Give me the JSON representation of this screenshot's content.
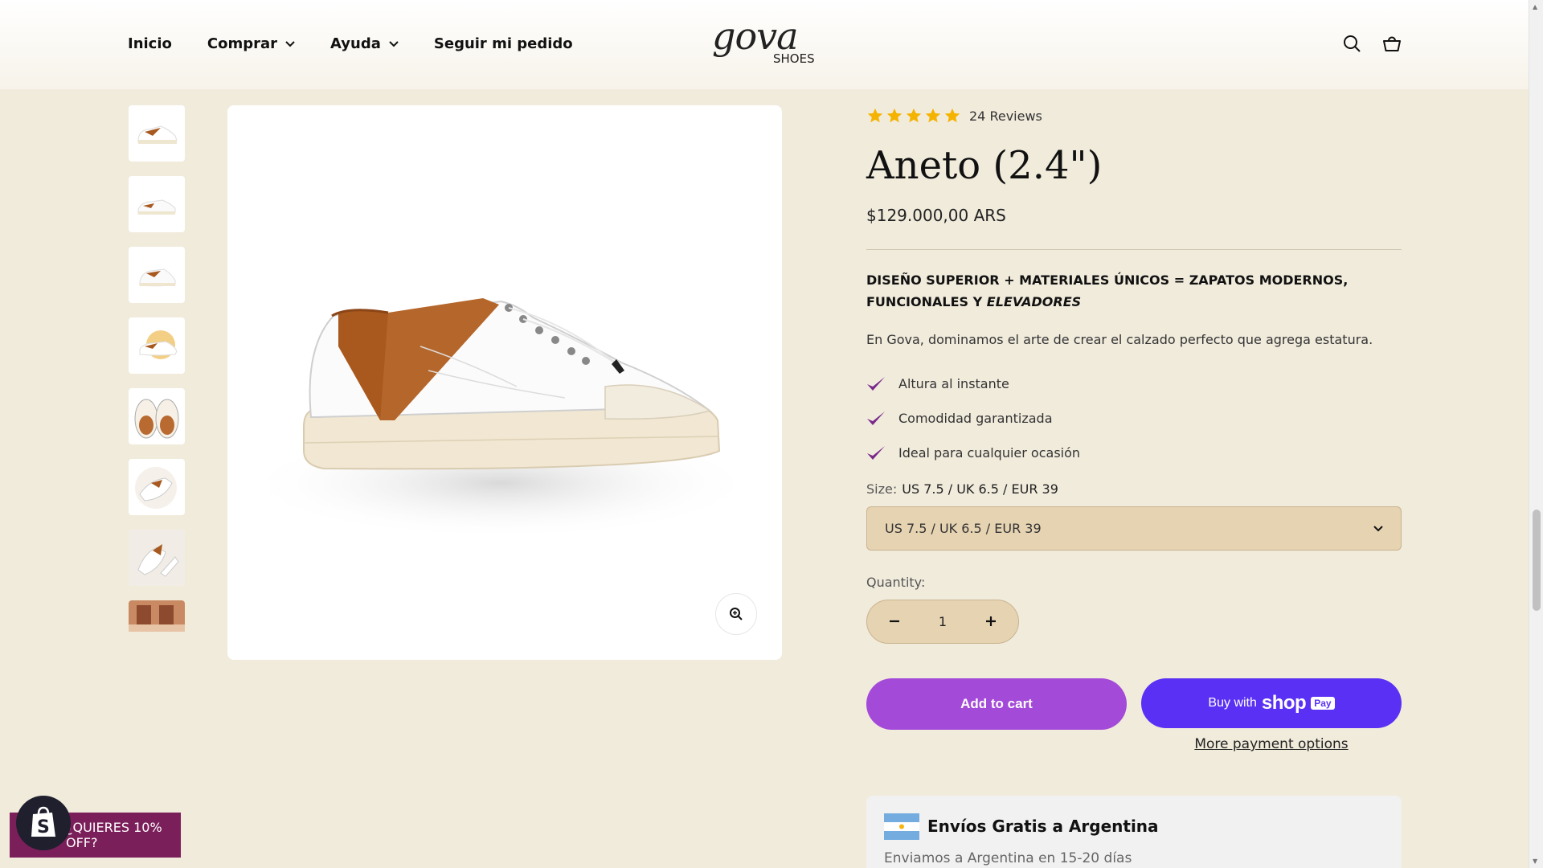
{
  "nav": {
    "items": [
      {
        "label": "Inicio"
      },
      {
        "label": "Comprar"
      },
      {
        "label": "Ayuda"
      },
      {
        "label": "Seguir mi pedido"
      }
    ]
  },
  "logo": {
    "word": "gova",
    "sub": "SHOES"
  },
  "product": {
    "reviews": "24 Reviews",
    "rating": 5,
    "title": "Aneto (2.4\")",
    "price": "$129.000,00 ARS",
    "headline_main": "DISEÑO SUPERIOR + MATERIALES ÚNICOS = ZAPATOS MODERNOS, FUNCIONALES Y ",
    "headline_em": "ELEVADORES",
    "description": "En Gova, dominamos el arte de crear el calzado perfecto que agrega estatura.",
    "features": [
      "Altura al instante",
      "Comodidad garantizada",
      "Ideal para cualquier ocasión"
    ],
    "size_label": "Size:",
    "size_value": "US 7.5 / UK 6.5 / EUR 39",
    "size_selected": "US 7.5 / UK 6.5 / EUR 39",
    "qty_label": "Quantity:",
    "qty_value": "1",
    "add_to_cart": "Add to cart",
    "buy_with": "Buy with",
    "shop_word": "shop",
    "pay_badge": "Pay",
    "more_payment": "More payment options"
  },
  "shipping": {
    "title": "Envíos Gratis a Argentina",
    "subtitle": "Enviamos a Argentina en 15-20 días"
  },
  "promo": {
    "label": "¿QUIERES 10% OFF?"
  },
  "colors": {
    "background": "#f1ebdc",
    "accent_purple": "#a44ad8",
    "shop_pay": "#5a31f4",
    "check_purple": "#7a2a8c",
    "select_bg": "#e6d3b2",
    "star": "#f5b301",
    "promo": "#7b1f5a"
  },
  "icons": [
    "chevron-down-icon",
    "search-icon",
    "cart-icon",
    "star-icon",
    "check-icon",
    "zoom-icon",
    "minus-icon",
    "plus-icon",
    "shopify-icon",
    "argentina-flag-icon"
  ]
}
